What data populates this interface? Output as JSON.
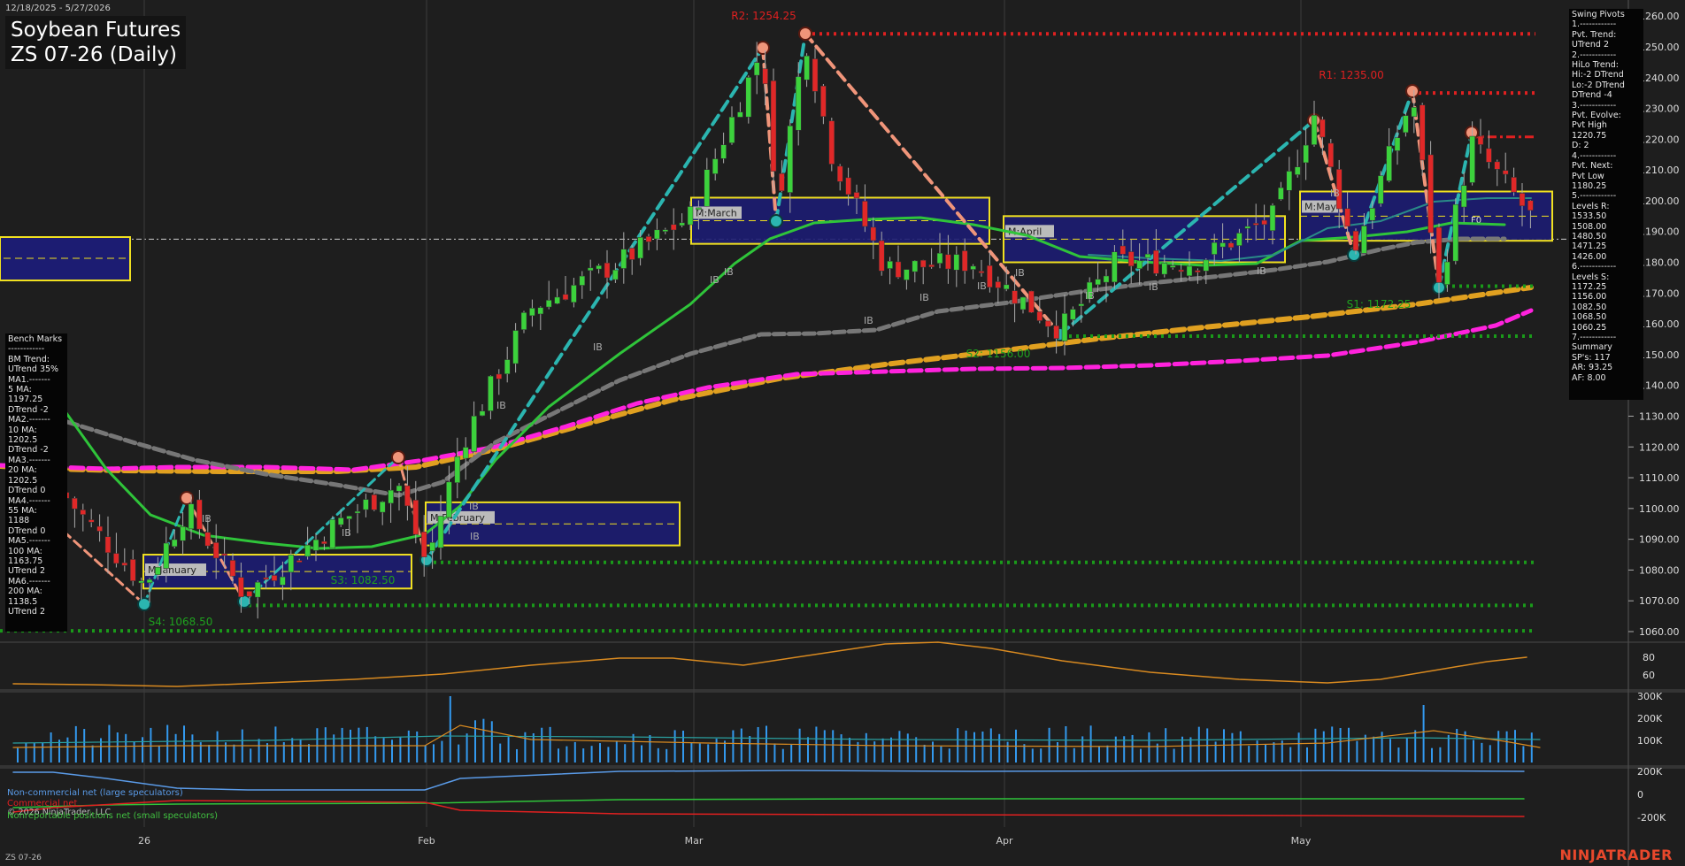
{
  "header": {
    "date_range": "12/18/2025 - 5/27/2026",
    "title_line1": "Soybean Futures",
    "title_line2": "ZS 07-26 (Daily)"
  },
  "footer": {
    "symbol": "ZS 07-26",
    "copyright": "© 2026 NinjaTrader, LLC",
    "brand": "NINJATRADER"
  },
  "swing_pivots": [
    "Swing Pivots",
    "1.------------",
    "Pvt. Trend:",
    "UTrend 2",
    "2.------------",
    "HiLo Trend:",
    "Hi:-2 DTrend",
    "Lo:-2 DTrend",
    "DTrend -4",
    "3.------------",
    "Pvt. Evolve:",
    "Pvt High",
    "1220.75",
    "D: 2",
    "4.------------",
    "Pvt. Next:",
    "Pvt Low",
    "1180.25",
    "5.------------",
    "Levels R:",
    "1533.50",
    "1508.00",
    "1480.50",
    "1471.25",
    "1426.00",
    "6.------------",
    "Levels S:",
    "1172.25",
    "1156.00",
    "1082.50",
    "1068.50",
    "1060.25",
    "7.------------",
    "Summary",
    "SP's: 117",
    "AR: 93.25",
    "AF: 8.00"
  ],
  "bench_marks": [
    "Bench Marks",
    "------------",
    "BM Trend:",
    "UTrend 35%",
    "MA1.-------",
    "5 MA:",
    "1197.25",
    "DTrend -2",
    "MA2.-------",
    "10 MA:",
    "1202.5",
    "DTrend -2",
    "MA3.-------",
    "20 MA:",
    "1202.5",
    "DTrend 0",
    "MA4.-------",
    "55 MA:",
    "1188",
    "DTrend 0",
    "MA5.-------",
    "100 MA:",
    "1163.75",
    "UTrend 2",
    "MA6.-------",
    "200 MA:",
    "1138.5",
    "UTrend 2"
  ],
  "legend": {
    "noncommercial": "Non-commercial net (large speculators)",
    "commercial": "Commercial net",
    "nonreportable": "Nonreportable positions net (small speculators)"
  },
  "colors": {
    "background": "#1e1e1e",
    "up_candle": "#3cd23c",
    "down_candle": "#e02828",
    "ma_green": "#2fc43a",
    "ma_gray": "#777777",
    "ma_magenta": "#ff22dd",
    "ma_orange": "#e0a020",
    "resistance": "#e02020",
    "support": "#1a9a1a",
    "pivot_teal": "#2bb5b0",
    "pivot_salmon": "#f0957a",
    "volume": "#3399ee"
  },
  "chart_data": {
    "type": "candlestick",
    "x_axis_labels": [
      "26",
      "Feb",
      "Mar",
      "Apr",
      "May"
    ],
    "y_axis": {
      "ticks": [
        1060,
        1070,
        1080,
        1090,
        1100,
        1110,
        1120,
        1130,
        1140,
        1150,
        1160,
        1170,
        1180,
        1190,
        1200,
        1210,
        1220,
        1230,
        1240,
        1250,
        1260
      ],
      "tick_labels": [
        "1060.00",
        "1070.00",
        "1080.00",
        "1090.00",
        "1100.00",
        "1110.00",
        "1120.00",
        "1130.00",
        "1140.00",
        "1150.00",
        "1160.00",
        "1170.00",
        "1180.00",
        "1190.00",
        "1200.00",
        "1210.00",
        "1220.00",
        "1230.00",
        "1240.00",
        "1250.00",
        "1260.00"
      ],
      "range": [
        1057,
        1265
      ]
    },
    "price_labels": [
      {
        "text": "R2: 1254.25",
        "level": 1254.25,
        "type": "resistance"
      },
      {
        "text": "R1: 1235.00",
        "level": 1235.0,
        "type": "resistance"
      },
      {
        "text": "S1: 1172.25",
        "level": 1172.25,
        "type": "support"
      },
      {
        "text": "S2: 1156.00",
        "level": 1156.0,
        "type": "support"
      },
      {
        "text": "S3: 1082.50",
        "level": 1082.5,
        "type": "support"
      },
      {
        "text": "S4: 1068.50",
        "level": 1068.5,
        "type": "support"
      }
    ],
    "extra_levels": [
      1220.75,
      1060.25
    ],
    "seasonal_boxes": [
      {
        "label": "M:January",
        "low": 1074,
        "high": 1085
      },
      {
        "label": "M:February",
        "low": 1088,
        "high": 1102
      },
      {
        "label": "M:March",
        "low": 1186,
        "high": 1201
      },
      {
        "label": "M:April",
        "low": 1180,
        "high": 1195
      },
      {
        "label": "M:May",
        "low": 1187,
        "high": 1203
      }
    ],
    "box_label_extra": "F0",
    "ib_label": "IB",
    "oscillator": {
      "tick_labels": [
        "80",
        "60"
      ],
      "ticks": [
        80,
        60
      ]
    },
    "volume": {
      "tick_labels": [
        "300K",
        "200K",
        "100K"
      ],
      "ticks": [
        300000,
        200000,
        100000
      ]
    },
    "cot": {
      "tick_labels": [
        "200K",
        "0",
        "-200K"
      ],
      "ticks": [
        200000,
        0,
        -200000
      ]
    }
  }
}
